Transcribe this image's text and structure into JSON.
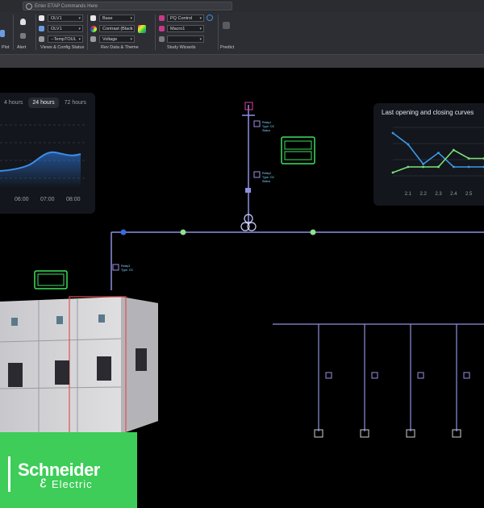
{
  "command_bar": {
    "placeholder": "Enter ETAP Commands Here"
  },
  "ribbon": {
    "groups": [
      {
        "label": "Plot"
      },
      {
        "label": "Alert"
      },
      {
        "label": "Views & Config Status"
      },
      {
        "label": "Rev Data & Theme"
      },
      {
        "label": "Study Wizards"
      },
      {
        "label": "Predict"
      }
    ],
    "views_combos": [
      "OLV1",
      "OLV1",
      "--TempTOUL"
    ],
    "rev_combos": [
      "Base",
      "Contrast (Black",
      "Voltage"
    ],
    "study_combos": [
      "PQ Control",
      "Macro1",
      ""
    ]
  },
  "trend_panel": {
    "tabs": [
      "4 hours",
      "24 hours",
      "72 hours"
    ],
    "active_tab": "24 hours",
    "x_ticks": [
      "06:00",
      "07:00",
      "08:00"
    ]
  },
  "curves_panel": {
    "title": "Last opening and closing curves",
    "x_ticks": [
      "2.1",
      "2.2",
      "2.3",
      "2.4",
      "2.5"
    ]
  },
  "brand": {
    "name": "Schneider",
    "sub": "Electric",
    "color": "#3dcd58"
  },
  "chart_data": [
    {
      "type": "area",
      "title": "",
      "x": [
        "06:00",
        "07:00",
        "08:00"
      ],
      "series": [
        {
          "values": [
            0.3,
            0.62,
            0.5
          ]
        }
      ]
    },
    {
      "type": "line",
      "title": "Last opening and closing curves",
      "x": [
        2.0,
        2.1,
        2.2,
        2.3,
        2.4,
        2.5,
        2.6
      ],
      "series": [
        {
          "color": "#3b9ae8",
          "values": [
            0.9,
            0.7,
            0.35,
            0.55,
            0.3,
            0.3,
            0.3
          ]
        },
        {
          "color": "#7be07b",
          "values": [
            0.2,
            0.3,
            0.3,
            0.3,
            0.6,
            0.45,
            0.45
          ]
        }
      ]
    }
  ],
  "colors": {
    "bus": "#8f8fe0",
    "node": "#8fe08f",
    "ribbon": "#2d2e33",
    "accent": "#e040a0"
  }
}
